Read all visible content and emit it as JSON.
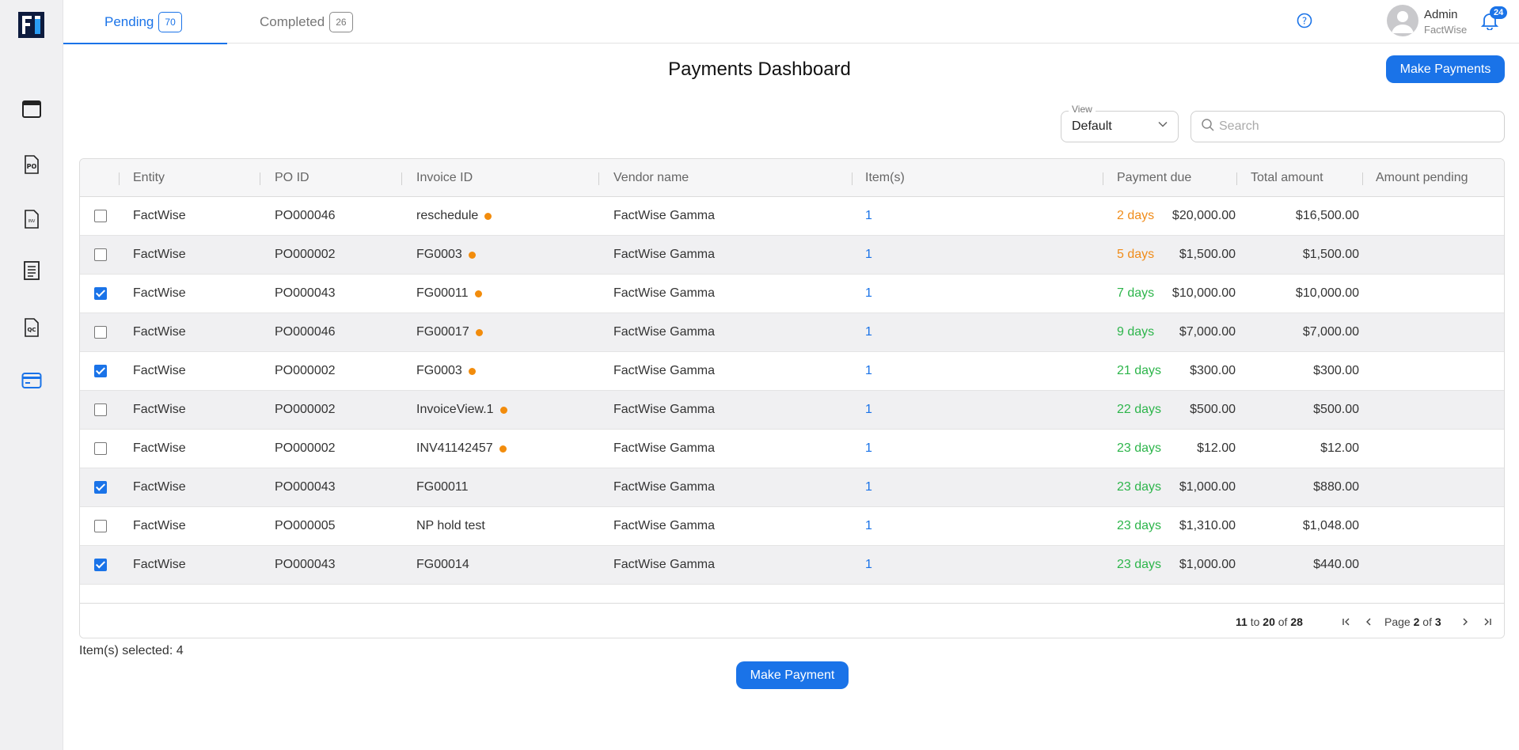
{
  "tabs": [
    {
      "label": "Pending",
      "count": "70"
    },
    {
      "label": "Completed",
      "count": "26"
    }
  ],
  "user": {
    "name": "Admin",
    "org": "FactWise",
    "notifications": "24"
  },
  "page_title": "Payments Dashboard",
  "make_payments_label": "Make Payments",
  "view": {
    "legend": "View",
    "value": "Default"
  },
  "search": {
    "placeholder": "Search"
  },
  "columns": [
    "Entity",
    "PO ID",
    "Invoice ID",
    "Vendor name",
    "Item(s)",
    "Payment due",
    "Total amount",
    "Amount pending"
  ],
  "rows": [
    {
      "checked": false,
      "entity": "FactWise",
      "po": "PO000046",
      "invoice": "reschedule",
      "dot": true,
      "vendor": "FactWise Gamma",
      "items": "1",
      "due": "2 days",
      "due_status": "orange",
      "total": "$20,000.00",
      "pending": "$16,500.00"
    },
    {
      "checked": false,
      "entity": "FactWise",
      "po": "PO000002",
      "invoice": "FG0003",
      "dot": true,
      "vendor": "FactWise Gamma",
      "items": "1",
      "due": "5 days",
      "due_status": "orange",
      "total": "$1,500.00",
      "pending": "$1,500.00"
    },
    {
      "checked": true,
      "entity": "FactWise",
      "po": "PO000043",
      "invoice": "FG00011",
      "dot": true,
      "vendor": "FactWise Gamma",
      "items": "1",
      "due": "7 days",
      "due_status": "green",
      "total": "$10,000.00",
      "pending": "$10,000.00"
    },
    {
      "checked": false,
      "entity": "FactWise",
      "po": "PO000046",
      "invoice": "FG00017",
      "dot": true,
      "vendor": "FactWise Gamma",
      "items": "1",
      "due": "9 days",
      "due_status": "green",
      "total": "$7,000.00",
      "pending": "$7,000.00"
    },
    {
      "checked": true,
      "entity": "FactWise",
      "po": "PO000002",
      "invoice": "FG0003",
      "dot": true,
      "vendor": "FactWise Gamma",
      "items": "1",
      "due": "21 days",
      "due_status": "green",
      "total": "$300.00",
      "pending": "$300.00"
    },
    {
      "checked": false,
      "entity": "FactWise",
      "po": "PO000002",
      "invoice": "InvoiceView.1",
      "dot": true,
      "vendor": "FactWise Gamma",
      "items": "1",
      "due": "22 days",
      "due_status": "green",
      "total": "$500.00",
      "pending": "$500.00"
    },
    {
      "checked": false,
      "entity": "FactWise",
      "po": "PO000002",
      "invoice": "INV41142457",
      "dot": true,
      "vendor": "FactWise Gamma",
      "items": "1",
      "due": "23 days",
      "due_status": "green",
      "total": "$12.00",
      "pending": "$12.00"
    },
    {
      "checked": true,
      "entity": "FactWise",
      "po": "PO000043",
      "invoice": "FG00011",
      "dot": false,
      "vendor": "FactWise Gamma",
      "items": "1",
      "due": "23 days",
      "due_status": "green",
      "total": "$1,000.00",
      "pending": "$880.00"
    },
    {
      "checked": false,
      "entity": "FactWise",
      "po": "PO000005",
      "invoice": "NP hold test",
      "dot": false,
      "vendor": "FactWise Gamma",
      "items": "1",
      "due": "23 days",
      "due_status": "green",
      "total": "$1,310.00",
      "pending": "$1,048.00"
    },
    {
      "checked": true,
      "entity": "FactWise",
      "po": "PO000043",
      "invoice": "FG00014",
      "dot": false,
      "vendor": "FactWise Gamma",
      "items": "1",
      "due": "23 days",
      "due_status": "green",
      "total": "$1,000.00",
      "pending": "$440.00"
    }
  ],
  "pagination": {
    "from": "11",
    "to_word": "to",
    "to": "20",
    "of_word": "of",
    "total": "28",
    "page_word": "Page",
    "page": "2",
    "pages": "3"
  },
  "selected_text": "Item(s) selected: 4",
  "make_payment_label": "Make Payment",
  "colors": {
    "accent": "#1a73e8",
    "due_soon": "#f08c1a",
    "due_ok": "#2db54b",
    "dot": "#f28c0c"
  },
  "icons": {
    "sidebar": [
      "calendar-icon",
      "po-document-icon",
      "invoice-document-icon",
      "list-document-icon",
      "qc-document-icon",
      "payment-card-icon"
    ]
  }
}
